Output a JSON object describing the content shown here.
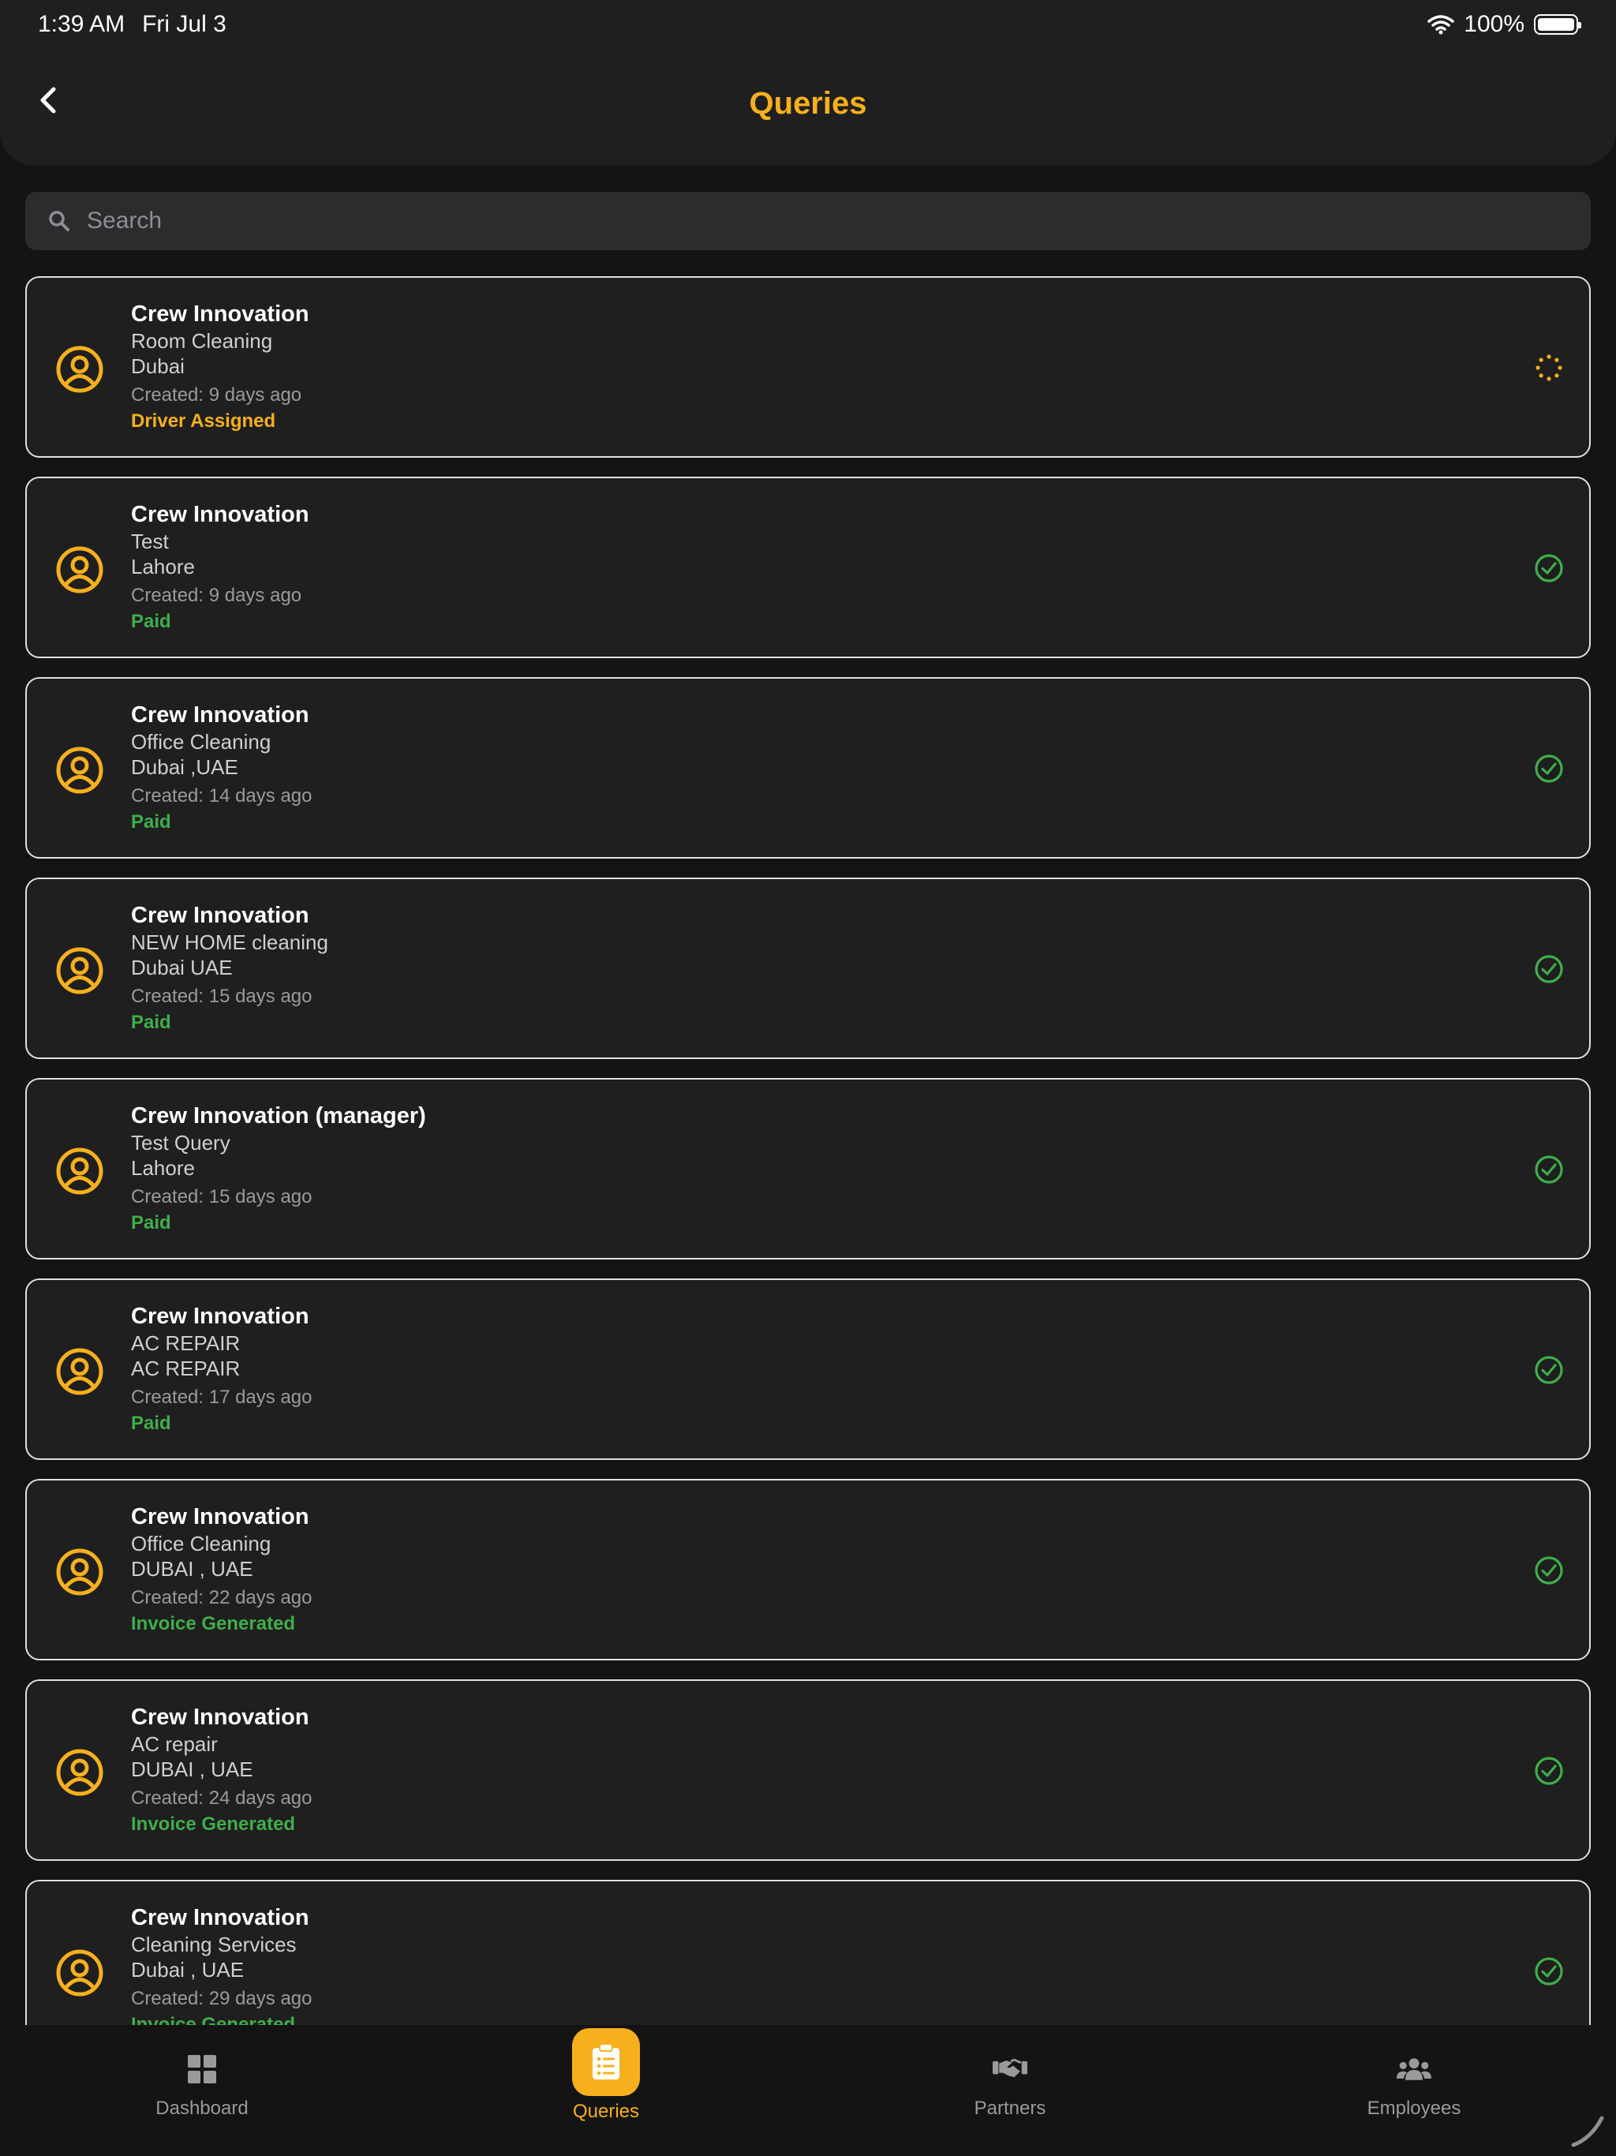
{
  "status_bar": {
    "time": "1:39 AM",
    "date": "Fri Jul 3",
    "battery": "100%"
  },
  "header": {
    "title": "Queries"
  },
  "search": {
    "placeholder": "Search"
  },
  "colors": {
    "accent": "#f6b01e",
    "success": "#3fae4a"
  },
  "queries": [
    {
      "name": "Crew Innovation",
      "service": "Room Cleaning",
      "location": "Dubai",
      "created": "Created: 9 days ago",
      "status": "Driver Assigned",
      "status_type": "pending"
    },
    {
      "name": "Crew Innovation",
      "service": "Test",
      "location": "Lahore",
      "created": "Created: 9 days ago",
      "status": "Paid",
      "status_type": "done"
    },
    {
      "name": "Crew Innovation",
      "service": "Office Cleaning",
      "location": "Dubai ,UAE",
      "created": "Created: 14 days ago",
      "status": "Paid",
      "status_type": "done"
    },
    {
      "name": "Crew Innovation",
      "service": "NEW HOME cleaning",
      "location": "Dubai UAE",
      "created": "Created: 15 days ago",
      "status": "Paid",
      "status_type": "done"
    },
    {
      "name": "Crew Innovation (manager)",
      "service": "Test Query",
      "location": "Lahore",
      "created": "Created: 15 days ago",
      "status": "Paid",
      "status_type": "done"
    },
    {
      "name": "Crew Innovation",
      "service": "AC REPAIR",
      "location": "AC REPAIR",
      "created": "Created: 17 days ago",
      "status": "Paid",
      "status_type": "done"
    },
    {
      "name": "Crew Innovation",
      "service": "Office Cleaning",
      "location": "DUBAI , UAE",
      "created": "Created: 22 days ago",
      "status": "Invoice Generated",
      "status_type": "done"
    },
    {
      "name": "Crew Innovation",
      "service": "AC repair",
      "location": "DUBAI , UAE",
      "created": "Created: 24 days ago",
      "status": "Invoice Generated",
      "status_type": "done"
    },
    {
      "name": "Crew Innovation",
      "service": "Cleaning Services",
      "location": "Dubai , UAE",
      "created": "Created: 29 days ago",
      "status": "Invoice Generated",
      "status_type": "done"
    }
  ],
  "tabs": [
    {
      "label": "Dashboard",
      "icon": "grid-icon",
      "active": false
    },
    {
      "label": "Queries",
      "icon": "clipboard-icon",
      "active": true
    },
    {
      "label": "Partners",
      "icon": "handshake-icon",
      "active": false
    },
    {
      "label": "Employees",
      "icon": "users-icon",
      "active": false
    }
  ]
}
